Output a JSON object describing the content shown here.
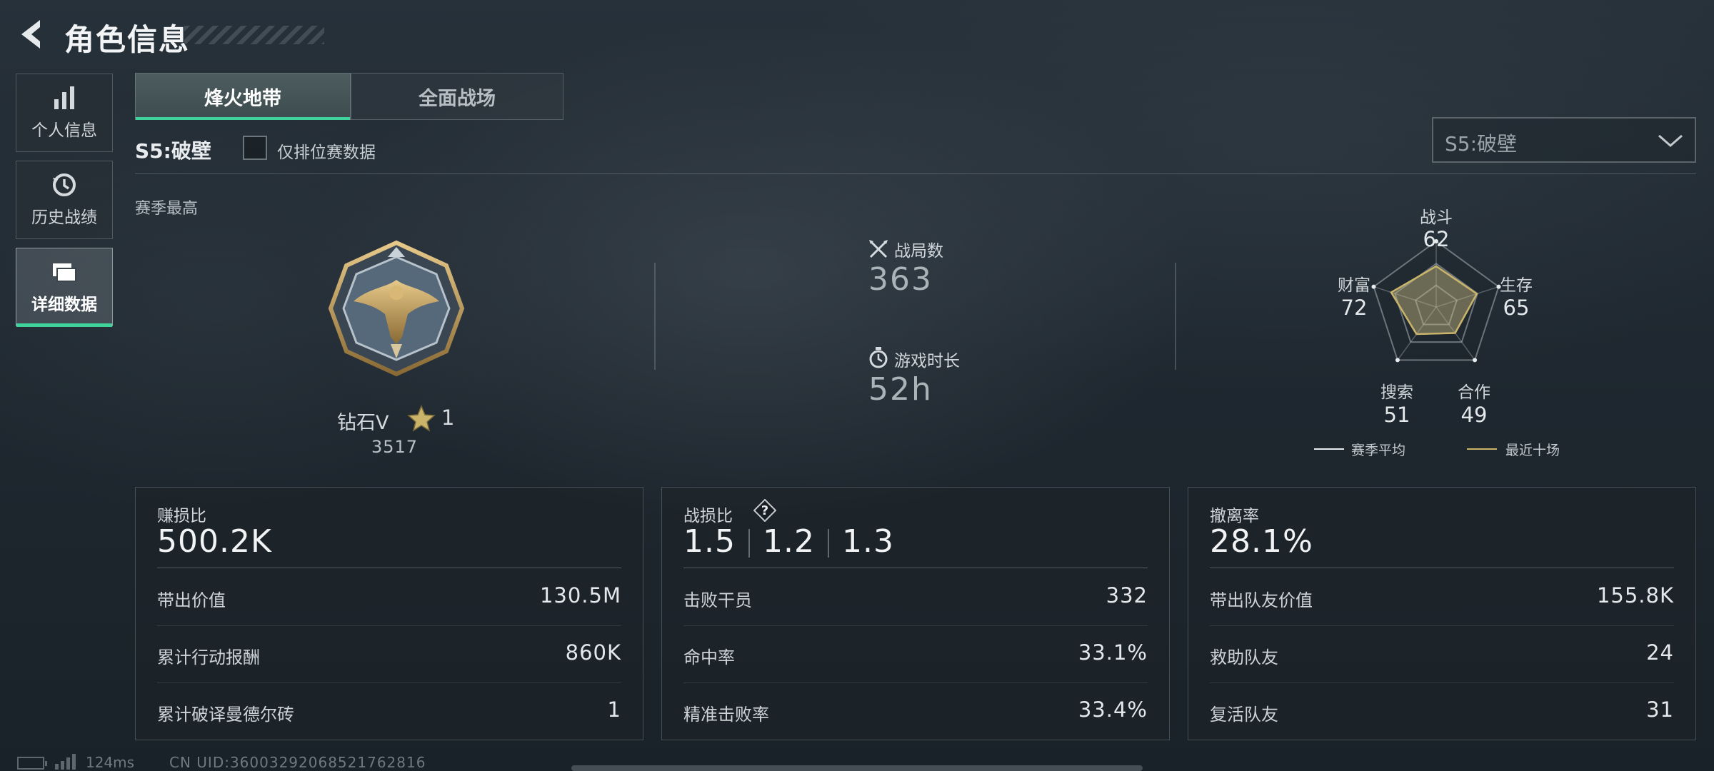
{
  "header": {
    "title": "角色信息",
    "back_icon": "back-arrow-icon"
  },
  "sidebar": {
    "items": [
      {
        "label": "个人信息",
        "icon": "bar-chart-icon",
        "active": false
      },
      {
        "label": "历史战绩",
        "icon": "history-icon",
        "active": false
      },
      {
        "label": "详细数据",
        "icon": "cards-icon",
        "active": true
      }
    ]
  },
  "mode_tabs": [
    {
      "label": "烽火地带",
      "active": true
    },
    {
      "label": "全面战场",
      "active": false
    }
  ],
  "season": {
    "label": "S5:破壁",
    "ranked_only_label": "仅排位赛数据",
    "ranked_only_checked": false,
    "selector_value": "S5:破壁"
  },
  "season_best": {
    "label": "赛季最高",
    "rank_name": "钻石V",
    "stars": "1",
    "score": "3517"
  },
  "stats": {
    "matches_label": "战局数",
    "matches_value": "363",
    "playtime_label": "游戏时长",
    "playtime_value": "52h"
  },
  "radar": {
    "axes": [
      {
        "label": "战斗",
        "value": "62",
        "season_avg": 62,
        "recent_ten": 62
      },
      {
        "label": "生存",
        "value": "65",
        "season_avg": 65,
        "recent_ten": 65
      },
      {
        "label": "合作",
        "value": "49",
        "season_avg": 49,
        "recent_ten": 49
      },
      {
        "label": "搜索",
        "value": "51",
        "season_avg": 51,
        "recent_ten": 51
      },
      {
        "label": "财富",
        "value": "72",
        "season_avg": 72,
        "recent_ten": 72
      }
    ],
    "legend": {
      "season_avg": "赛季平均",
      "recent_ten": "最近十场"
    },
    "colors": {
      "season_avg": "#e8ecee",
      "recent_ten": "#c9b46a"
    }
  },
  "cards": {
    "profit": {
      "title": "赚损比",
      "big": "500.2K",
      "rows": [
        {
          "label": "带出价值",
          "value": "130.5M"
        },
        {
          "label": "累计行动报酬",
          "value": "860K"
        },
        {
          "label": "累计破译曼德尔砖",
          "value": "1"
        }
      ]
    },
    "combat": {
      "title": "战损比",
      "ratios": [
        "1.5",
        "1.2",
        "1.3"
      ],
      "rows": [
        {
          "label": "击败干员",
          "value": "332"
        },
        {
          "label": "命中率",
          "value": "33.1%"
        },
        {
          "label": "精准击败率",
          "value": "33.4%"
        }
      ]
    },
    "extract": {
      "title": "撤离率",
      "big": "28.1%",
      "rows": [
        {
          "label": "带出队友价值",
          "value": "155.8K"
        },
        {
          "label": "救助队友",
          "value": "24"
        },
        {
          "label": "复活队友",
          "value": "31"
        }
      ]
    }
  },
  "footer": {
    "ping": "124ms",
    "uid": "CN UID:36003292068521762816"
  },
  "colors": {
    "accent": "#3fd29a",
    "gold": "#c9b46a"
  }
}
